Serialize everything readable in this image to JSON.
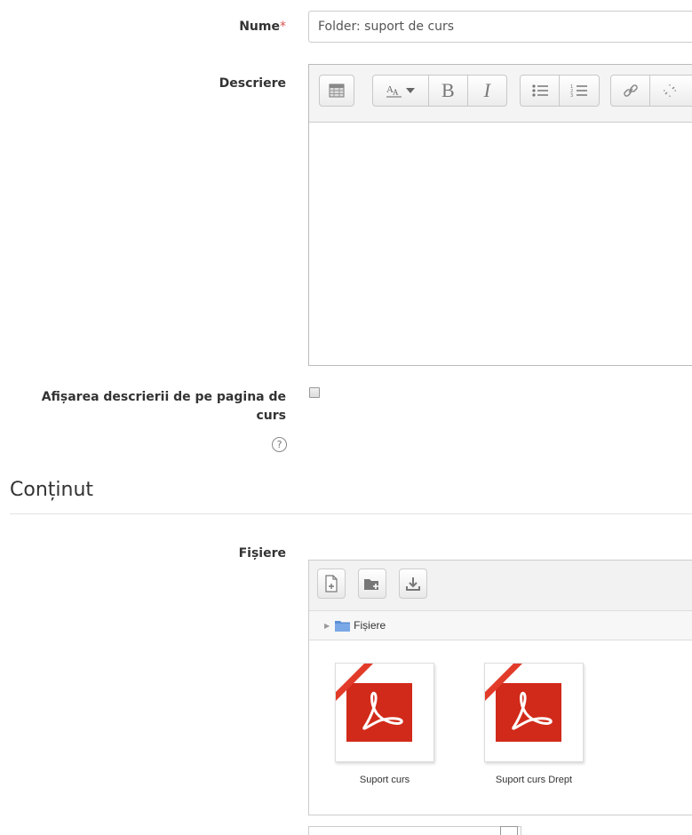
{
  "form": {
    "nume_label": "Nume",
    "nume_required_mark": "*",
    "nume_value": "Folder: suport de curs",
    "descriere_label": "Descriere",
    "afisare_label_line1": "Afișarea descrierii de pe pagina de",
    "afisare_label_line2": "curs",
    "help_glyph": "?"
  },
  "editor_toolbar": {
    "icons": [
      "table-icon",
      "font-size-icon",
      "bold-icon",
      "italic-icon",
      "bullet-list-icon",
      "numbered-list-icon",
      "link-icon",
      "unlink-icon"
    ],
    "bold_glyph": "B",
    "italic_glyph": "I"
  },
  "section": {
    "title": "Conținut"
  },
  "files": {
    "label": "Fișiere",
    "path_label": "Fișiere",
    "toolbar_icons": [
      "add-file-icon",
      "create-folder-icon",
      "download-icon"
    ],
    "items": [
      {
        "name": "Suport curs",
        "type_icon": "pdf-icon"
      },
      {
        "name": "Suport curs Drept",
        "type_icon": "pdf-icon"
      }
    ]
  },
  "colors": {
    "required": "#d9534f",
    "pdf_red": "#d12a1a",
    "folder_blue": "#5b8fd6"
  }
}
